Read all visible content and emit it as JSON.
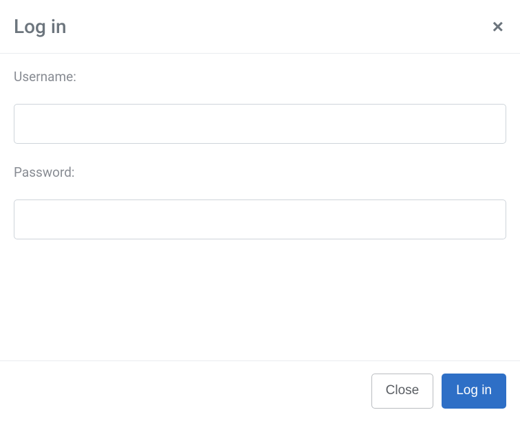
{
  "modal": {
    "title": "Log in",
    "close_icon": "×"
  },
  "form": {
    "username": {
      "label": "Username:",
      "value": ""
    },
    "password": {
      "label": "Password:",
      "value": ""
    }
  },
  "footer": {
    "close_label": "Close",
    "login_label": "Log in"
  }
}
